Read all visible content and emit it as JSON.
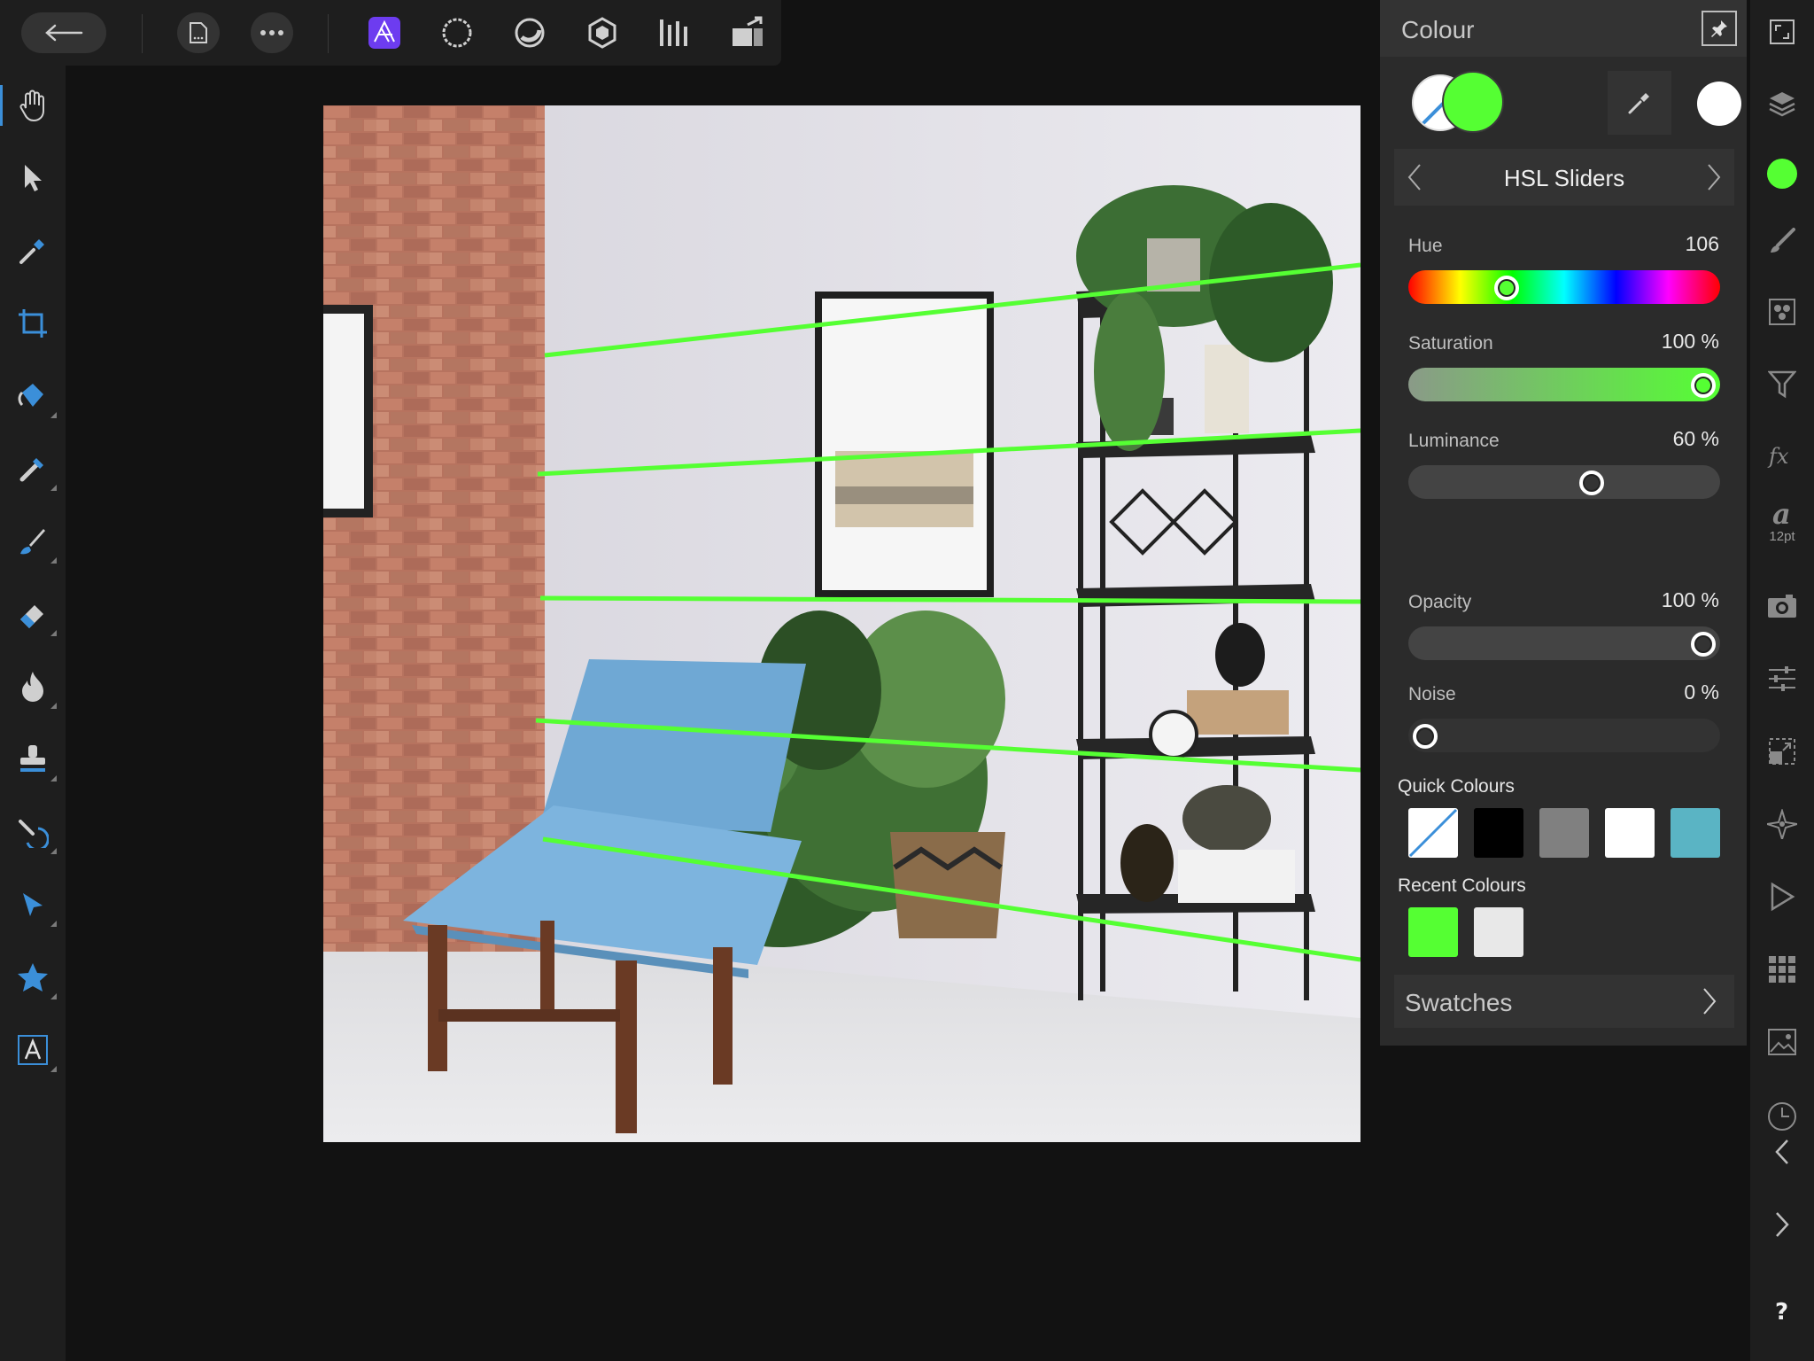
{
  "toolbar": {
    "items": [
      "back-arrow-icon",
      "document-icon",
      "more-icon",
      "photo-persona-icon",
      "liquify-persona-icon",
      "develop-persona-icon",
      "tone-mapping-persona-icon",
      "export-persona-icon"
    ]
  },
  "tools": [
    "view-tool",
    "move-tool",
    "colour-picker-tool",
    "crop-tool",
    "flood-fill-tool",
    "selection-brush-tool",
    "paint-brush-tool",
    "erase-brush-tool",
    "dodge-burn-tool",
    "clone-tool",
    "inpainting-tool",
    "pen-tool",
    "shape-tool",
    "text-tool"
  ],
  "colour_panel": {
    "title": "Colour",
    "primary_colour": "#55ff33",
    "mode": "HSL Sliders",
    "sliders": [
      {
        "label": "Hue",
        "value": "106",
        "fraction": 0.2944
      },
      {
        "label": "Saturation",
        "value": "100 %",
        "fraction": 1.0
      },
      {
        "label": "Luminance",
        "value": "60 %",
        "fraction": 0.6
      },
      {
        "label": "Opacity",
        "value": "100 %",
        "fraction": 1.0
      },
      {
        "label": "Noise",
        "value": "0 %",
        "fraction": 0.0
      }
    ],
    "quick_colours_label": "Quick Colours",
    "quick_colours": [
      "none",
      "#000000",
      "#808080",
      "#ffffff",
      "#5ab4c4"
    ],
    "recent_colours_label": "Recent Colours",
    "recent_colours": [
      "#55ff33",
      "#e8e8e8"
    ],
    "swatches_label": "Swatches"
  },
  "studio": {
    "text_size": "12pt"
  }
}
